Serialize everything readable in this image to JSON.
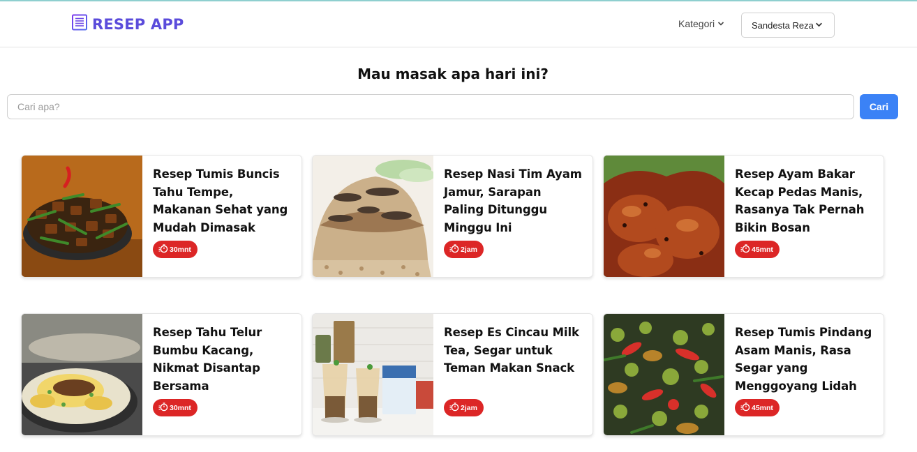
{
  "app": {
    "title": "RESEP APP",
    "logo_icon": "notebook-icon",
    "brand_color": "#5b4cdb"
  },
  "nav": {
    "kategori_label": "Kategori",
    "user_name": "Sandesta Reza"
  },
  "main": {
    "heading": "Mau masak apa hari ini?",
    "search": {
      "placeholder": "Cari apa?",
      "value": "",
      "button_label": "Cari",
      "button_color": "#3b82f6"
    }
  },
  "recipes": [
    {
      "title": "Resep Tumis Buncis Tahu Tempe, Makanan Sehat yang Mudah Dimasak",
      "time": "30mnt",
      "image": "stir-fried-beans-tofu-tempeh"
    },
    {
      "title": "Resep Nasi Tim Ayam Jamur, Sarapan Paling Ditunggu Minggu Ini",
      "time": "2jam",
      "image": "steamed-chicken-mushroom-rice"
    },
    {
      "title": "Resep Ayam Bakar Kecap Pedas Manis, Rasanya Tak Pernah Bikin Bosan",
      "time": "45mnt",
      "image": "grilled-chicken"
    },
    {
      "title": "Resep Tahu Telur Bumbu Kacang, Nikmat Disantap Bersama",
      "time": "30mnt",
      "image": "tofu-omelette-peanut-sauce"
    },
    {
      "title": "Resep Es Cincau Milk Tea, Segar untuk Teman Makan Snack",
      "time": "2jam",
      "image": "grass-jelly-milk-tea"
    },
    {
      "title": "Resep Tumis Pindang Asam Manis, Rasa Segar yang Menggoyang Lidah",
      "time": "45mnt",
      "image": "sweet-sour-fish-stir-fry"
    }
  ],
  "badge_color": "#dc2626"
}
